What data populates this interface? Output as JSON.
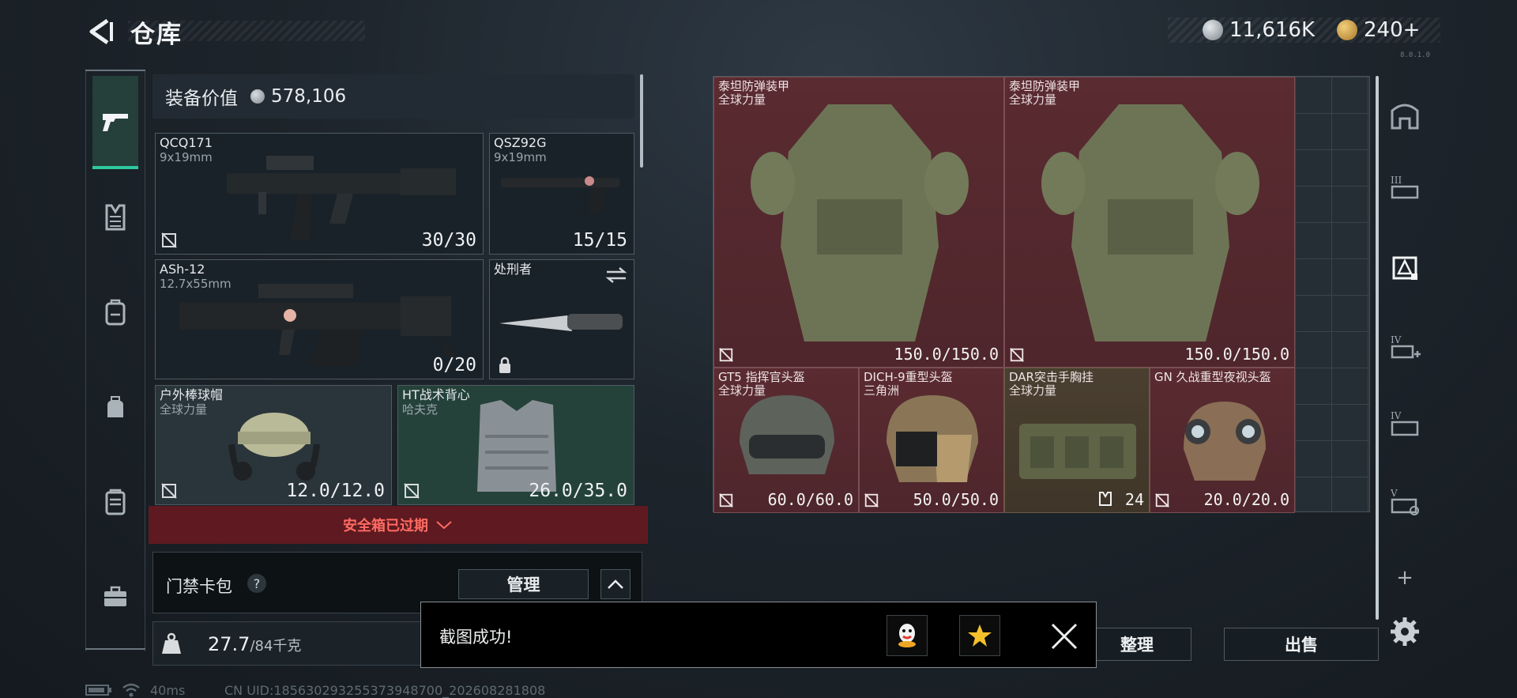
{
  "header": {
    "title": "仓库"
  },
  "currency": {
    "silver": "11,616K",
    "gold": "240+",
    "silver_color": "#b9c0c6",
    "gold_color": "#d6a54a"
  },
  "version_text": "8.0.1.0",
  "equipment": {
    "value_label": "装备价值",
    "value": "578,106",
    "slots": [
      {
        "name": "QCQ171",
        "sub": "9x19mm",
        "count": "30/30"
      },
      {
        "name": "QSZ92G",
        "sub": "9x19mm",
        "count": "15/15"
      },
      {
        "name": "ASh-12",
        "sub": "12.7x55mm",
        "count": "0/20"
      },
      {
        "name": "处刑者",
        "sub": "",
        "count": ""
      },
      {
        "name": "户外棒球帽",
        "sub": "全球力量",
        "count": "12.0/12.0"
      },
      {
        "name": "HT战术背心",
        "sub": "哈夫克",
        "count": "26.0/35.0"
      }
    ],
    "warning": "安全箱已过期",
    "keycard_label": "门禁卡包",
    "help": "?",
    "manage_button": "管理",
    "weight_value": "27.7",
    "weight_max": "/84千克"
  },
  "stash_items": [
    {
      "name": "泰坦防弹装甲",
      "sub": "全球力量",
      "count": "150.0/150.0"
    },
    {
      "name": "泰坦防弹装甲",
      "sub": "全球力量",
      "count": "150.0/150.0"
    },
    {
      "name": "GT5 指挥官头盔",
      "sub": "全球力量",
      "count": "60.0/60.0"
    },
    {
      "name": "DICH-9重型头盔",
      "sub": "三角洲",
      "count": "50.0/50.0"
    },
    {
      "name": "DAR突击手胸挂",
      "sub": "全球力量",
      "count": "24"
    },
    {
      "name": "GN 久战重型夜视头盔",
      "sub": "",
      "count": "20.0/20.0"
    }
  ],
  "right_nav": {
    "add": "+"
  },
  "buttons": {
    "sort": "整理",
    "sell": "出售"
  },
  "toast": {
    "message": "截图成功!"
  },
  "status_bar": {
    "ping": "40ms",
    "uid": "CN UID:18563029325537394870​0_202608281808"
  }
}
